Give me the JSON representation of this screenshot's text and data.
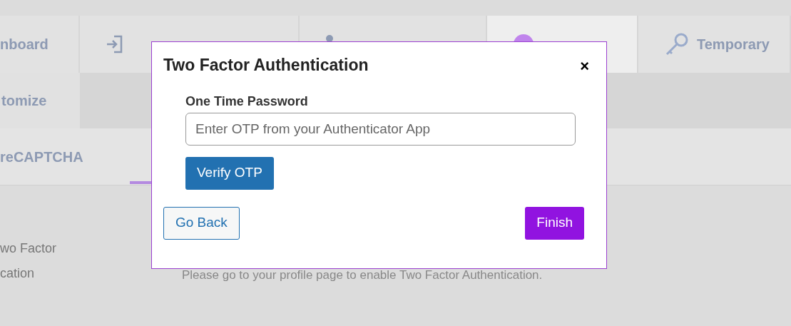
{
  "background": {
    "tabs": [
      {
        "label": "nboard",
        "selected": false
      },
      {
        "selected": false
      },
      {
        "selected": false
      },
      {
        "selected": true
      },
      {
        "label": "Temporary",
        "selected": false
      }
    ],
    "second_row": "tomize",
    "subtab": "reCAPTCHA",
    "setting_label": [
      "wo Factor",
      "cation"
    ],
    "message": "Please go to your profile page to enable Two Factor Authentication."
  },
  "dialog": {
    "title": "Two Factor Authentication",
    "close": "×",
    "field_label": "One Time Password",
    "placeholder": "Enter OTP from your Authenticator App",
    "verify_button": "Verify OTP",
    "back_button": "Go Back",
    "finish_button": "Finish"
  }
}
